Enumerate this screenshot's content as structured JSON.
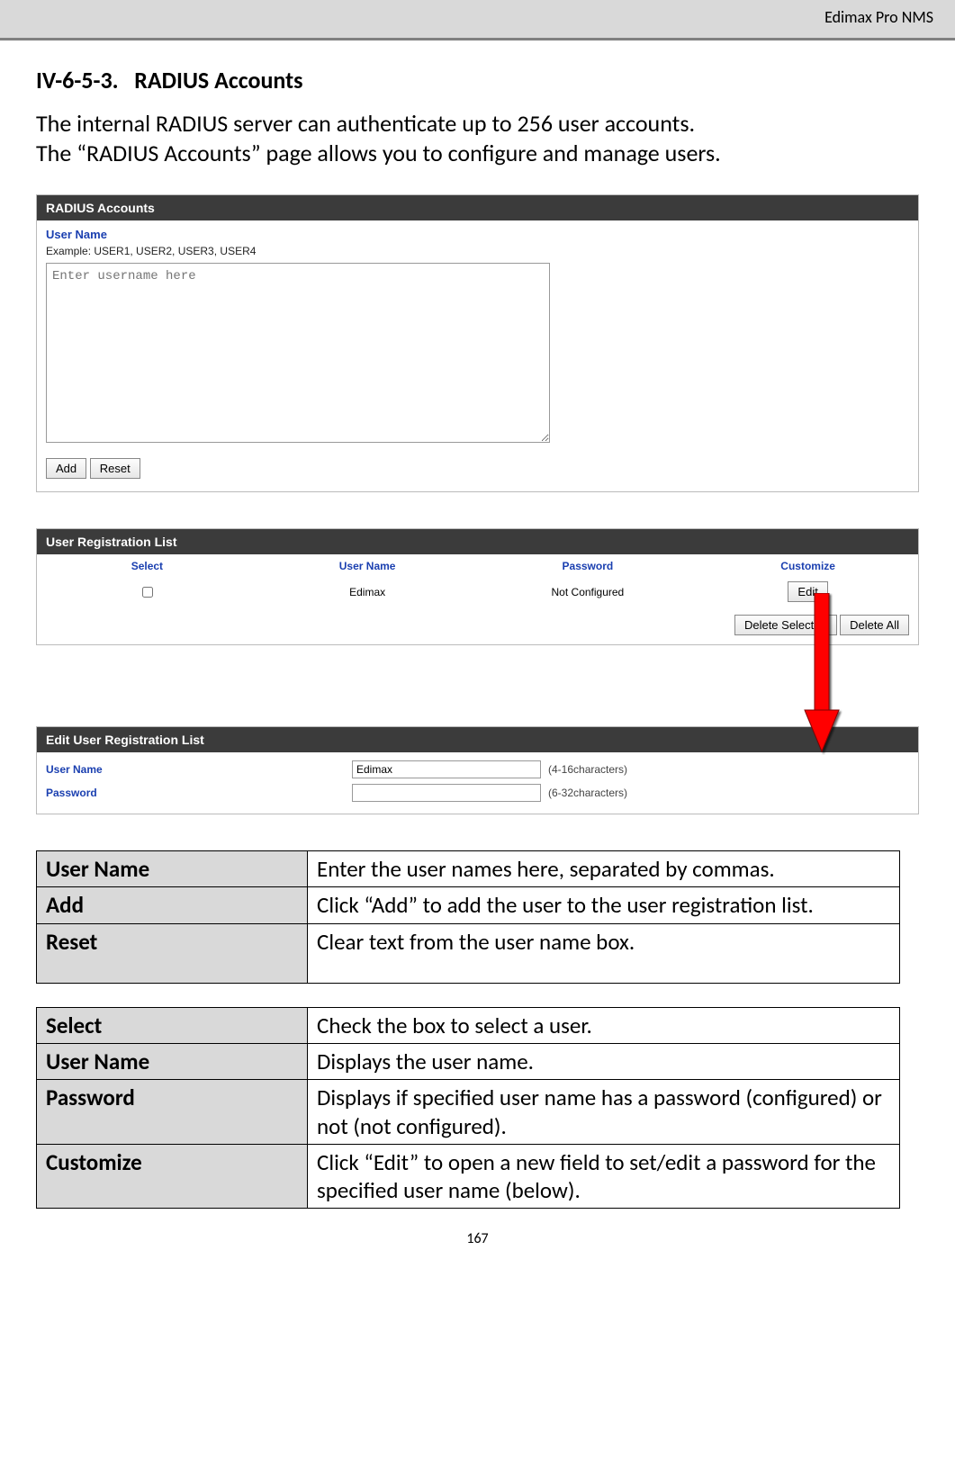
{
  "header": {
    "product": "Edimax Pro NMS"
  },
  "section": {
    "number": "IV-6-5-3.",
    "title": "RADIUS Accounts",
    "intro_line1": "The internal RADIUS server can authenticate up to 256 user accounts.",
    "intro_line2": "The “RADIUS Accounts” page allows you to configure and manage users."
  },
  "panel_accounts": {
    "title": "RADIUS Accounts",
    "username_label": "User Name",
    "example": "Example: USER1, USER2, USER3, USER4",
    "textarea_placeholder": "Enter username here",
    "add_btn": "Add",
    "reset_btn": "Reset"
  },
  "panel_reglist": {
    "title": "User Registration List",
    "cols": {
      "select": "Select",
      "username": "User Name",
      "password": "Password",
      "customize": "Customize"
    },
    "row": {
      "username": "Edimax",
      "password": "Not Configured",
      "edit_btn": "Edit"
    },
    "delete_selected_btn": "Delete Selected",
    "delete_all_btn": "Delete All"
  },
  "panel_edit": {
    "title": "Edit User Registration List",
    "username_label": "User Name",
    "username_value": "Edimax",
    "username_hint": "(4-16characters)",
    "password_label": "Password",
    "password_value": "",
    "password_hint": "(6-32characters)"
  },
  "table1": {
    "rows": [
      {
        "key": "User Name",
        "val": "Enter the user names here, separated by commas."
      },
      {
        "key": "Add",
        "val": "Click “Add” to add the user to the user registration list."
      },
      {
        "key": "Reset",
        "val": "Clear text from the user name box."
      }
    ]
  },
  "table2": {
    "rows": [
      {
        "key": "Select",
        "val": "Check the box to select a user."
      },
      {
        "key": "User Name",
        "val": "Displays the user name."
      },
      {
        "key": "Password",
        "val": "Displays if specified user name has a password (configured) or not (not configured)."
      },
      {
        "key": "Customize",
        "val": "Click “Edit” to open a new field to set/edit a password for the specified user name (below)."
      }
    ]
  },
  "page_number": "167"
}
